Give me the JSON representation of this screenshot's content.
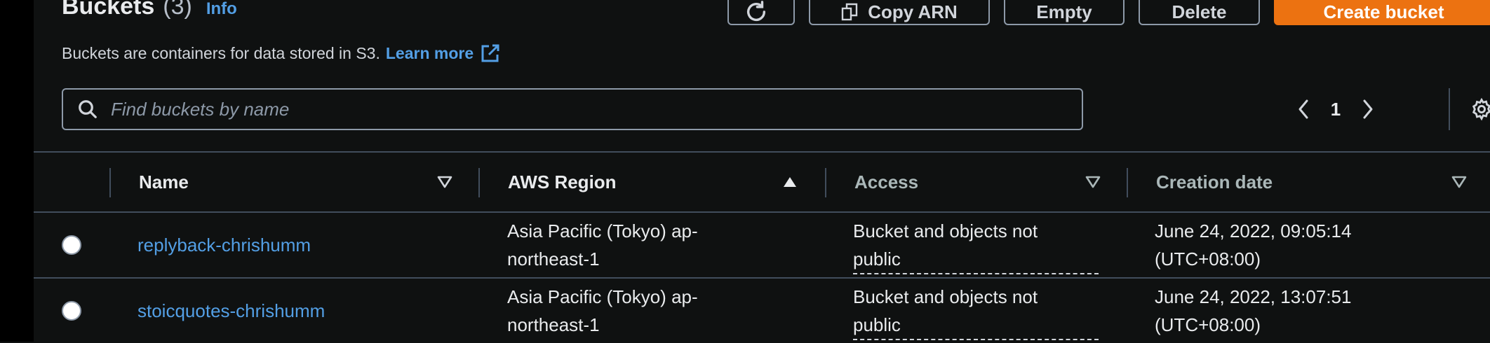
{
  "header": {
    "title": "Buckets",
    "count": "(3)",
    "info": "Info",
    "description": "Buckets are containers for data stored in S3.",
    "learn_more": "Learn more"
  },
  "toolbar": {
    "copy_arn": "Copy ARN",
    "empty": "Empty",
    "delete": "Delete",
    "create": "Create bucket"
  },
  "search": {
    "placeholder": "Find buckets by name"
  },
  "pagination": {
    "current_page": "1"
  },
  "table": {
    "columns": [
      "Name",
      "AWS Region",
      "Access",
      "Creation date"
    ],
    "rows": [
      {
        "name": "replyback-chrishumm",
        "region_line1": "Asia Pacific (Tokyo) ap-",
        "region_line2": "northeast-1",
        "access_line1": "Bucket and objects not",
        "access_line2": "public",
        "date_line1": "June 24, 2022, 09:05:14",
        "date_line2": "(UTC+08:00)"
      },
      {
        "name": "stoicquotes-chrishumm",
        "region_line1": "Asia Pacific (Tokyo) ap-",
        "region_line2": "northeast-1",
        "access_line1": "Bucket and objects not",
        "access_line2": "public",
        "date_line1": "June 24, 2022, 13:07:51",
        "date_line2": "(UTC+08:00)"
      }
    ]
  },
  "icons": {
    "refresh": "refresh-icon",
    "copy": "copy-icon",
    "external": "external-link-icon",
    "search": "search-icon",
    "prev": "chevron-left-icon",
    "next": "chevron-right-icon",
    "settings": "gear-icon",
    "sort_desc": "sort-down-outline-icon",
    "sort_asc": "sort-up-filled-icon"
  },
  "colors": {
    "background": "#0f1111",
    "link": "#539fe5",
    "primary_button": "#ec7211",
    "border": "#414d5c"
  }
}
